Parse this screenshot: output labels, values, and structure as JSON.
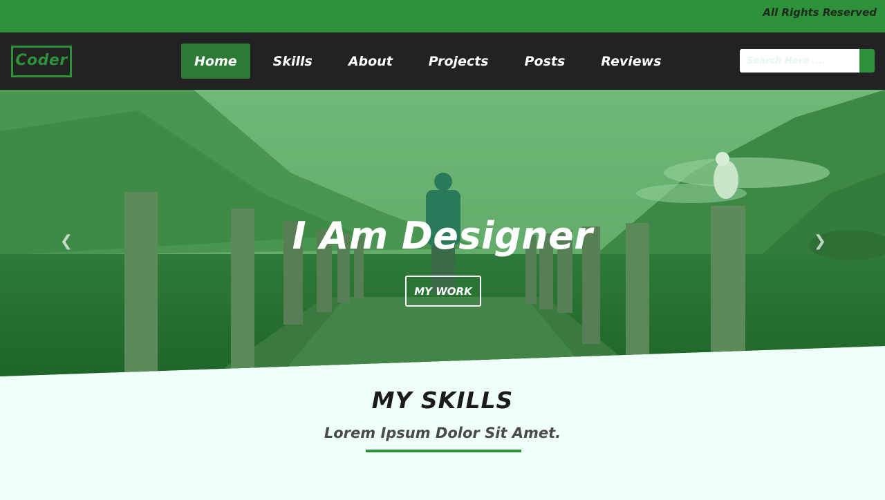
{
  "topbar": {
    "text": "All Rights Reserved"
  },
  "navbar": {
    "logo": "Coder",
    "items": [
      {
        "label": "Home",
        "active": true
      },
      {
        "label": "Skills",
        "active": false
      },
      {
        "label": "About",
        "active": false
      },
      {
        "label": "Projects",
        "active": false
      },
      {
        "label": "Posts",
        "active": false
      },
      {
        "label": "Reviews",
        "active": false
      }
    ],
    "search": {
      "placeholder": "Search Here ....",
      "value": ""
    }
  },
  "hero": {
    "title": "I Am Designer",
    "button": "MY WORK",
    "prev_icon": "chevron-left-icon",
    "next_icon": "chevron-right-icon"
  },
  "skills": {
    "title": "MY SKILLS",
    "subtitle": "Lorem Ipsum Dolor Sit Amet."
  },
  "colors": {
    "accent": "#2f913a",
    "navbar_bg": "#222222",
    "page_bg": "#effef9"
  }
}
